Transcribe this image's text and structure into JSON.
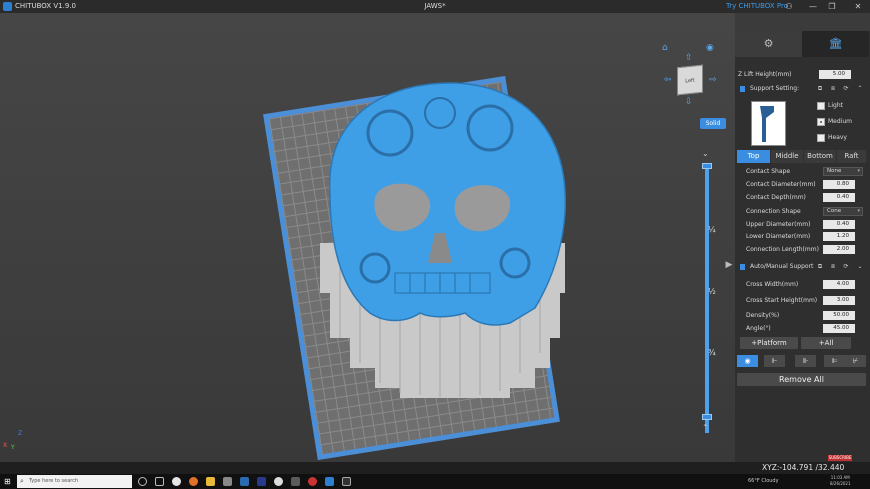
{
  "window": {
    "app_name": "CHITUBOX V1.9.0",
    "title": "JAWS*",
    "try_pro": "Try CHITUBOX Pro",
    "user_icon": "user-icon",
    "minimize_icon": "minimize-icon",
    "maximize_icon": "maximize-icon",
    "close_icon": "close-icon"
  },
  "viewport": {
    "solid_label": "Solid",
    "cube_label": "Left",
    "slider_marks": [
      "¼",
      "½",
      "¾"
    ],
    "gizmo": {
      "x": "X",
      "y": "Y",
      "z": "Z"
    },
    "plate_color": "#4a8fd8",
    "model_color": "#3f9fe6"
  },
  "panel": {
    "tabs": {
      "settings_icon": "gear-icon",
      "support_icon": "support-pillars-icon"
    },
    "z_lift": {
      "label": "Z Lift Height(mm)",
      "value": "5.00"
    },
    "support_setting": {
      "label": "Support Setting:"
    },
    "density_options": [
      {
        "label": "Light",
        "selected": false
      },
      {
        "label": "Medium",
        "selected": true
      },
      {
        "label": "Heavy",
        "selected": false
      }
    ],
    "subtabs": [
      "Top",
      "Middle",
      "Bottom",
      "Raft"
    ],
    "top_fields": {
      "contact_shape": {
        "label": "Contact Shape",
        "value": "None"
      },
      "contact_diameter": {
        "label": "Contact Diameter(mm)",
        "value": "0.80"
      },
      "contact_depth": {
        "label": "Contact Depth(mm)",
        "value": "0.40"
      },
      "connection_shape": {
        "label": "Connection Shape",
        "value": "Cone"
      },
      "upper_diameter": {
        "label": "Upper Diameter(mm)",
        "value": "0.40"
      },
      "lower_diameter": {
        "label": "Lower Diameter(mm)",
        "value": "1.20"
      },
      "connection_length": {
        "label": "Connection Length(mm)",
        "value": "2.00"
      }
    },
    "auto_manual": {
      "label": "Auto/Manual Support"
    },
    "auto_fields": {
      "cross_width": {
        "label": "Cross Width(mm)",
        "value": "4.00"
      },
      "cross_start_height": {
        "label": "Cross Start Height(mm)",
        "value": "3.00"
      },
      "density": {
        "label": "Density(%)",
        "value": "50.00"
      },
      "angle": {
        "label": "Angle(°)",
        "value": "45.00"
      }
    },
    "platform_button": "+Platform",
    "all_button": "+All",
    "remove_all_button": "Remove All"
  },
  "status": {
    "coords": "XYZ:-104.791 /32.440 /97.954",
    "record_badge": "SUBSCRIBE"
  },
  "taskbar": {
    "search_placeholder": "Type here to search",
    "weather": "66°F Cloudy",
    "time": "11:03 AM",
    "date": "8/26/2021"
  }
}
